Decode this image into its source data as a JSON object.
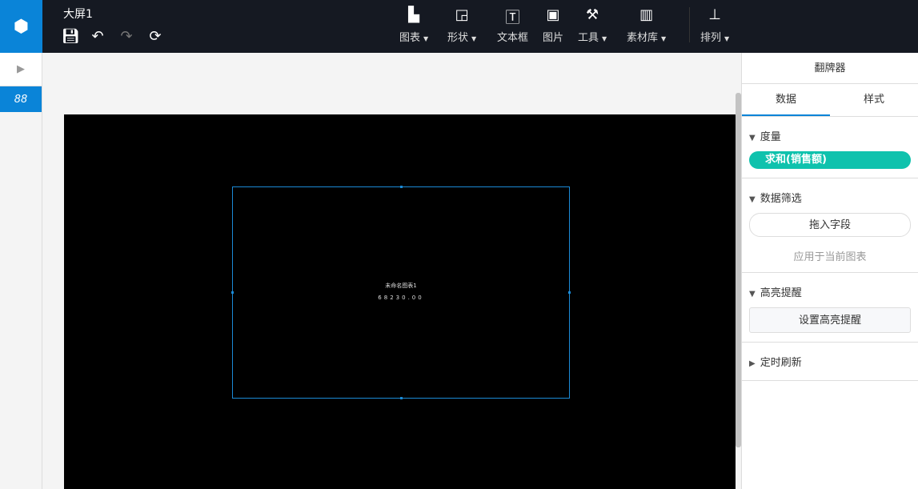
{
  "header": {
    "title": "大屏1",
    "toolbar": [
      {
        "label": "图表",
        "icon": "bar-chart-icon",
        "dd": true
      },
      {
        "label": "形状",
        "icon": "shape-icon",
        "dd": true
      },
      {
        "label": "文本框",
        "icon": "textbox-icon",
        "dd": false
      },
      {
        "label": "图片",
        "icon": "image-icon",
        "dd": false
      },
      {
        "label": "工具",
        "icon": "hammer-icon",
        "dd": true
      },
      {
        "label": "素材库",
        "icon": "library-icon",
        "dd": true
      },
      {
        "label": "排列",
        "icon": "align-icon",
        "dd": true
      }
    ]
  },
  "widget": {
    "title": "未命名图表1",
    "value": "68230.00"
  },
  "panel": {
    "title": "翻牌器",
    "tabs": [
      "数据",
      "样式"
    ],
    "measure_label": "度量",
    "measure_value": "求和(销售额)",
    "filter_label": "数据筛选",
    "drag_field": "拖入字段",
    "apply": "应用于当前图表",
    "highlight_label": "高亮提醒",
    "highlight_button": "设置高亮提醒",
    "refresh_label": "定时刷新"
  },
  "colors": {
    "accent": "#0a84d8",
    "pill": "#0fc2ad"
  }
}
